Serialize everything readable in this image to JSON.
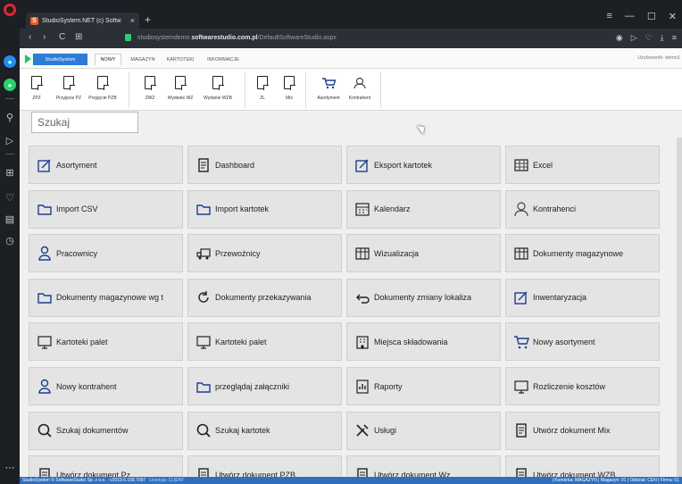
{
  "browser": {
    "tab_title": "StudioSystem.NET (c) Softw",
    "tab_close": "×",
    "new_tab": "+",
    "url_prefix": "studiosystemdemo.",
    "url_domain": "softwarestudio.com.pl",
    "url_path": "/DefaultSoftwareStudio.aspx",
    "minimize": "—",
    "maximize": "☐",
    "close": "✕"
  },
  "ribbon_tabs": {
    "studio": "StudioSystem",
    "tabs": [
      "NOWY",
      "MAGAZYN",
      "KARTOTEKI",
      "INFORMACJE"
    ],
    "active": "NOWY",
    "user": "Użytkownik: demo1"
  },
  "ribbon_buttons": [
    "ZPZ",
    "Przyjęcie PZ",
    "Przyjęcie PZB",
    "ZWZ",
    "Wydanie WZ",
    "Wydanie WZB",
    "ZL",
    "Mix",
    "Asortyment",
    "Kontrahent"
  ],
  "search": {
    "placeholder": "Szukaj"
  },
  "tiles": [
    "Asortyment",
    "Dashboard",
    "Eksport kartotek",
    "Excel",
    "Import CSV",
    "Import kartotek",
    "Kalendarz",
    "Kontrahenci",
    "Pracownicy",
    "Przewoźnicy",
    "Wizualizacja",
    "Dokumenty magazynowe",
    "Dokumenty magazynowe wg t",
    "Dokumenty przekazywania",
    "Dokumenty zmiany lokaliza",
    "Inwentaryzacja",
    "Kartoteki palet",
    "Kartoteki palet",
    "Miejsca składowania",
    "Nowy asortyment",
    "Nowy kontrahent",
    "przeglądaj załączniki",
    "Raporty",
    "Rozliczenie kosztów",
    "Szukaj dokumentów",
    "Szukaj kartotek",
    "Usługi",
    "Utwórz dokument Mix",
    "Utwórz dokument Pz",
    "Utwórz dokument PZB",
    "Utwórz dokument Wz",
    "Utwórz dokument WZB"
  ],
  "status": {
    "left": "StudioSystem © SoftwareStudio Sp. z o.o. - v2019.6.158.7097",
    "license_label": "Licencja:",
    "license_value": "CLIENT",
    "right": "| Komórka: MAGAZYN | Magazyn: 01 | Oddział: CEN | Firma: 01"
  }
}
